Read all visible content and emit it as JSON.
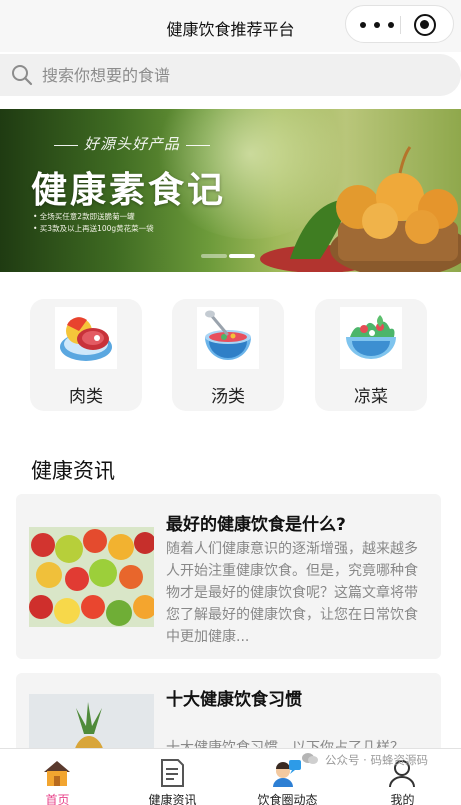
{
  "nav": {
    "title": "健康饮食推荐平台"
  },
  "search": {
    "placeholder": "搜索你想要的食谱"
  },
  "banner": {
    "subtitle": "好源头好产品",
    "title": "健康素食记",
    "promo_lines": [
      "• 全场买任意2款即送脆菊一罐",
      "• 买3款及以上再送100g黄花菜一袋"
    ],
    "active_slide": 2,
    "slide_count": 2
  },
  "categories": [
    {
      "label": "肉类",
      "icon": "meat-icon"
    },
    {
      "label": "汤类",
      "icon": "soup-icon"
    },
    {
      "label": "凉菜",
      "icon": "salad-icon"
    }
  ],
  "section": {
    "title": "健康资讯"
  },
  "articles": [
    {
      "title": "最好的健康饮食是什么?",
      "summary": "随着人们健康意识的逐渐增强，越来越多人开始注重健康饮食。但是，究竟哪种食物才是最好的健康饮食呢？这篇文章将带您了解最好的健康饮食，让您在日常饮食中更加健康...",
      "image": "fruits-vegetables-photo"
    },
    {
      "title": "十大健康饮食习惯",
      "summary": "十大健康饮食习惯，以下你占了几样？",
      "image": "pineapple-fruit-photo"
    }
  ],
  "tabbar": {
    "items": [
      {
        "label": "首页",
        "icon": "home-icon",
        "active": true
      },
      {
        "label": "健康资讯",
        "icon": "document-icon",
        "active": false
      },
      {
        "label": "饮食圈动态",
        "icon": "chat-person-icon",
        "active": false
      },
      {
        "label": "我的",
        "icon": "user-icon",
        "active": false
      }
    ]
  },
  "watermark": {
    "text": "公众号 · 码蜂资源码"
  },
  "colors": {
    "accent": "#e8438a",
    "banner_dot_active": "#ffffff",
    "card_bg": "#f4f4f4"
  }
}
